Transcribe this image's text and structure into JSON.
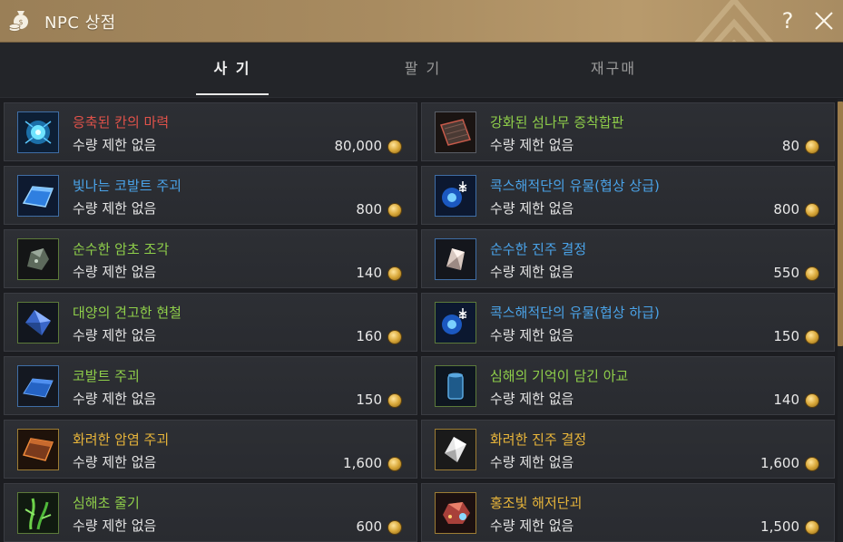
{
  "window": {
    "title": "NPC 상점",
    "help_label": "?",
    "title_icon": "money-bag-icon",
    "close_icon": "close-icon"
  },
  "tabs": [
    {
      "label": "사 기",
      "active": true
    },
    {
      "label": "팔 기",
      "active": false
    },
    {
      "label": "재구매",
      "active": false
    }
  ],
  "colors": {
    "accent_gold": "#a88b60",
    "red_name": "#e0524a",
    "blue_name": "#4aa3e8",
    "green_name": "#8fcf4a",
    "gold_name": "#e8b53a",
    "olive_name": "#b6c36a"
  },
  "items_left": [
    {
      "name": "응축된 칸의 마력",
      "limit": "수량 제한 없음",
      "price": "80,000",
      "name_color": "#e0524a",
      "icon": "blue-orb-icon",
      "frame": "blue"
    },
    {
      "name": "빛나는 코발트 주괴",
      "limit": "수량 제한 없음",
      "price": "800",
      "name_color": "#4aa3e8",
      "icon": "cobalt-ingot-glow-icon",
      "frame": "blue"
    },
    {
      "name": "순수한 암초 조각",
      "limit": "수량 제한 없음",
      "price": "140",
      "name_color": "#8fcf4a",
      "icon": "reef-shard-icon",
      "frame": "green"
    },
    {
      "name": "대양의 견고한 현철",
      "limit": "수량 제한 없음",
      "price": "160",
      "name_color": "#8fcf4a",
      "icon": "blue-crystal-icon",
      "frame": "green"
    },
    {
      "name": "코발트 주괴",
      "limit": "수량 제한 없음",
      "price": "150",
      "name_color": "#8fcf4a",
      "icon": "cobalt-ingot-icon",
      "frame": "blue"
    },
    {
      "name": "화려한 암염 주괴",
      "limit": "수량 제한 없음",
      "price": "1,600",
      "name_color": "#e8b53a",
      "icon": "rock-salt-ingot-icon",
      "frame": "gold"
    },
    {
      "name": "심해초 줄기",
      "limit": "수량 제한 없음",
      "price": "600",
      "name_color": "#8fcf4a",
      "icon": "seaweed-stem-icon",
      "frame": "green"
    }
  ],
  "items_right": [
    {
      "name": "강화된 섬나무 증착합판",
      "limit": "수량 제한 없음",
      "price": "80",
      "name_color": "#8fcf4a",
      "icon": "plywood-icon",
      "frame": "default"
    },
    {
      "name": "콕스해적단의 유물(협상 상급)",
      "limit": "수량 제한 없음",
      "price": "800",
      "name_color": "#4aa3e8",
      "icon": "pirate-relic-icon",
      "frame": "blue"
    },
    {
      "name": "순수한 진주 결정",
      "limit": "수량 제한 없음",
      "price": "550",
      "name_color": "#4aa3e8",
      "icon": "pearl-crystal-icon",
      "frame": "blue"
    },
    {
      "name": "콕스해적단의 유물(협상 하급)",
      "limit": "수량 제한 없음",
      "price": "150",
      "name_color": "#4aa3e8",
      "icon": "pirate-relic-icon",
      "frame": "green"
    },
    {
      "name": "심해의 기억이 담긴 아교",
      "limit": "수량 제한 없음",
      "price": "140",
      "name_color": "#8fcf4a",
      "icon": "glue-jar-icon",
      "frame": "green"
    },
    {
      "name": "화려한 진주 결정",
      "limit": "수량 제한 없음",
      "price": "1,600",
      "name_color": "#e8b53a",
      "icon": "pearl-crystal-bright-icon",
      "frame": "gold"
    },
    {
      "name": "홍조빛 해저단괴",
      "limit": "수량 제한 없음",
      "price": "1,500",
      "name_color": "#e8b53a",
      "icon": "red-nodule-icon",
      "frame": "gold"
    }
  ],
  "currency_icon": "silver-coin-icon"
}
